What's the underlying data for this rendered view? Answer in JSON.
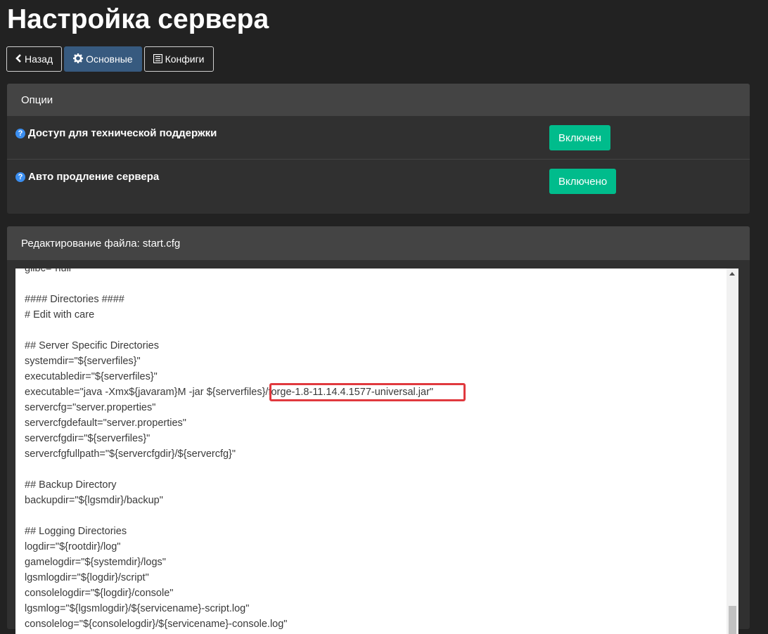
{
  "page": {
    "title": "Настройка сервера"
  },
  "nav": {
    "back_label": "Назад",
    "back_icon": "chevron-left-icon",
    "main_label": "Основные",
    "main_icon": "gear-icon",
    "configs_label": "Конфиги",
    "configs_icon": "list-icon"
  },
  "options": {
    "heading": "Опции",
    "items": [
      {
        "label": "Доступ для технической поддержки",
        "button": "Включен"
      },
      {
        "label": "Авто продление сервера",
        "button": "Включено"
      }
    ]
  },
  "editor": {
    "heading": "Редактирование файла: start.cfg",
    "lines": [
      "glibc=\"null\"",
      "",
      "#### Directories ####",
      "# Edit with care",
      "",
      "## Server Specific Directories",
      "systemdir=\"${serverfiles}\"",
      "executabledir=\"${serverfiles}\"",
      "executable=\"java -Xmx${javaram}M -jar ${serverfiles}/forge-1.8-11.14.4.1577-universal.jar\"",
      "servercfg=\"server.properties\"",
      "servercfgdefault=\"server.properties\"",
      "servercfgdir=\"${serverfiles}\"",
      "servercfgfullpath=\"${servercfgdir}/${servercfg}\"",
      "",
      "## Backup Directory",
      "backupdir=\"${lgsmdir}/backup\"",
      "",
      "## Logging Directories",
      "logdir=\"${rootdir}/log\"",
      "gamelogdir=\"${systemdir}/logs\"",
      "lgsmlogdir=\"${logdir}/script\"",
      "consolelogdir=\"${logdir}/console\"",
      "lgsmlog=\"${lgsmlogdir}/${servicename}-script.log\"",
      "consolelog=\"${consolelogdir}/${servicename}-console.log\""
    ]
  },
  "colors": {
    "background": "#222222",
    "panel": "#303030",
    "panel_heading": "#444444",
    "active_button": "#375a7f",
    "success_button": "#00bc8c",
    "help_icon": "#3b8ef0",
    "highlight": "#e0393e"
  }
}
